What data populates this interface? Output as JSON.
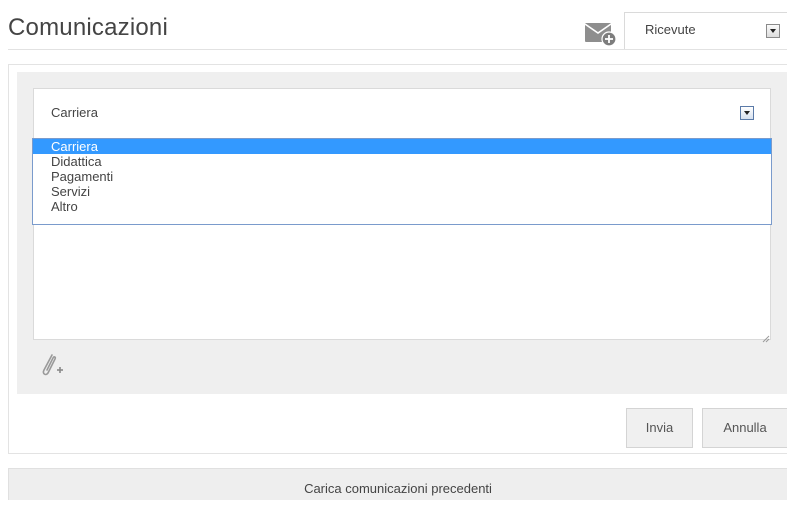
{
  "header": {
    "title": "Comunicazioni",
    "folder_select": {
      "value": "Ricevute"
    }
  },
  "compose": {
    "category_select": {
      "value": "Carriera",
      "options": [
        {
          "label": "Carriera",
          "selected": true
        },
        {
          "label": "Didattica",
          "selected": false
        },
        {
          "label": "Pagamenti",
          "selected": false
        },
        {
          "label": "Servizi",
          "selected": false
        },
        {
          "label": "Altro",
          "selected": false
        }
      ]
    },
    "send_label": "Invia",
    "cancel_label": "Annulla"
  },
  "footer": {
    "load_more_label": "Carica comunicazioni precedenti"
  },
  "icons": {
    "new_message": "mail-plus-icon",
    "attach": "paperclip-plus-icon"
  },
  "colors": {
    "selected_option": "#3399ff",
    "panel_gray": "#efefef"
  }
}
